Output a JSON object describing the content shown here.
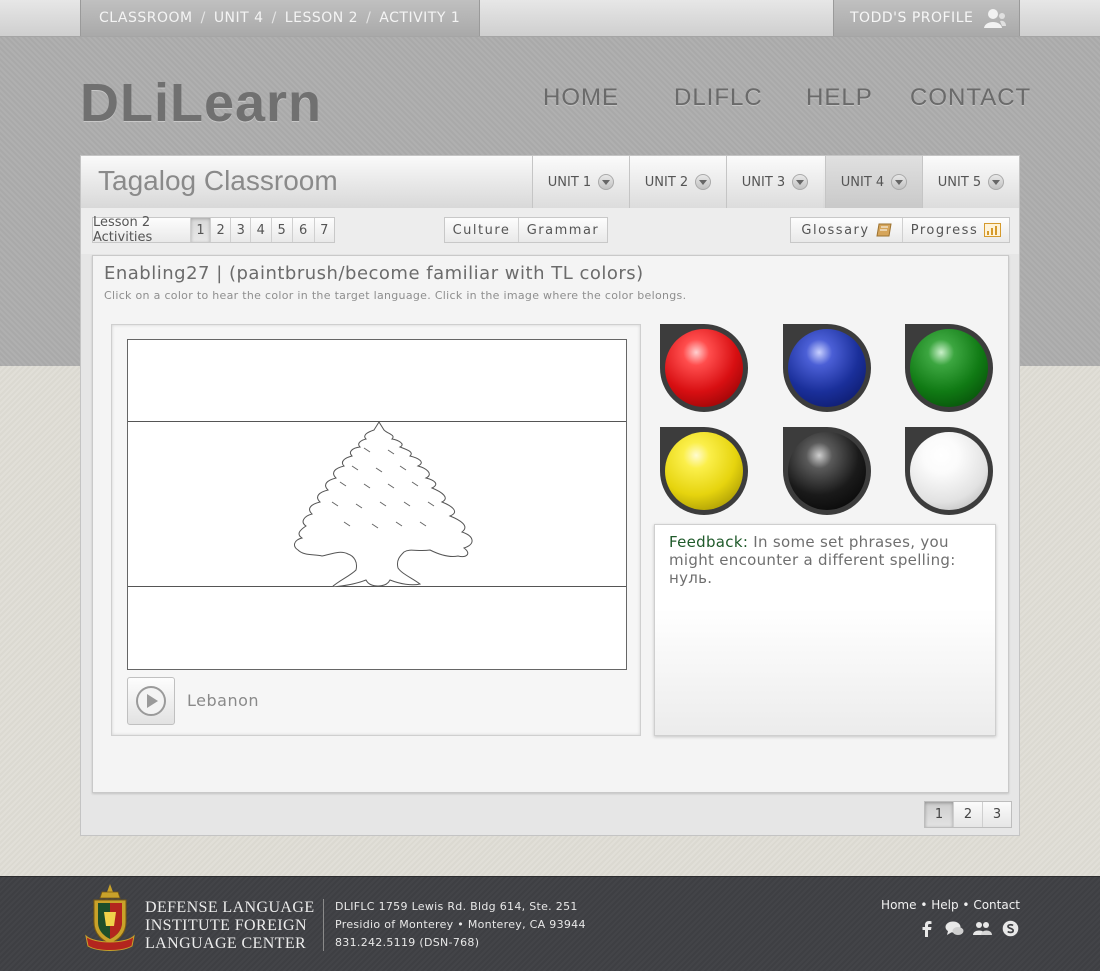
{
  "breadcrumb": [
    "CLASSROOM",
    "UNIT 4",
    "LESSON 2",
    "ACTIVITY 1"
  ],
  "breadcrumb_separator": "/",
  "profile": {
    "label": "TODD'S PROFILE",
    "icon": "user-icon"
  },
  "logo": "DLiLearn",
  "main_nav": [
    "HOME",
    "DLIFLC",
    "HELP",
    "CONTACT"
  ],
  "classroom": {
    "title": "Tagalog Classroom",
    "units": [
      "UNIT 1",
      "UNIT 2",
      "UNIT 3",
      "UNIT 4",
      "UNIT 5"
    ],
    "active_unit": "UNIT 4"
  },
  "activities": {
    "label": "Lesson 2  Activities",
    "numbers": [
      "1",
      "2",
      "3",
      "4",
      "5",
      "6",
      "7"
    ],
    "selected": "1"
  },
  "tools": {
    "culture": "Culture",
    "grammar": "Grammar",
    "glossary": "Glossary",
    "progress": "Progress"
  },
  "activity": {
    "title": "Enabling27 | (paintbrush/become familiar with TL colors)",
    "instructions": "Click on a color to hear the color in the target language. Click in the image where the color belongs.",
    "flag_name": "Lebanon",
    "play_icon": "play-icon"
  },
  "colors": [
    {
      "name": "red",
      "hex": "#d80f12"
    },
    {
      "name": "blue",
      "hex": "#1a2f9a"
    },
    {
      "name": "green",
      "hex": "#107a14"
    },
    {
      "name": "yellow",
      "hex": "#e6d40e"
    },
    {
      "name": "black",
      "hex": "#1a1a1a"
    },
    {
      "name": "white",
      "hex": "#f6f6f6"
    }
  ],
  "feedback": {
    "label": "Feedback:",
    "text": "In some set phrases, you might encounter a different spelling: нуль."
  },
  "pagination": {
    "pages": [
      "1",
      "2",
      "3"
    ],
    "selected": "1"
  },
  "footer": {
    "org_lines": [
      "DEFENSE LANGUAGE",
      "INSTITUTE FOREIGN",
      "LANGUAGE CENTER"
    ],
    "address_lines": [
      "DLIFLC 1759 Lewis Rd. Bldg 614, Ste. 251",
      "Presidio of Monterey • Monterey, CA 93944",
      "831.242.5119 (DSN-768)"
    ],
    "links": [
      "Home",
      "Help",
      "Contact"
    ],
    "link_separator": "•",
    "social_icons": [
      "facebook-icon",
      "chat-icon",
      "group-icon",
      "skype-icon"
    ]
  }
}
